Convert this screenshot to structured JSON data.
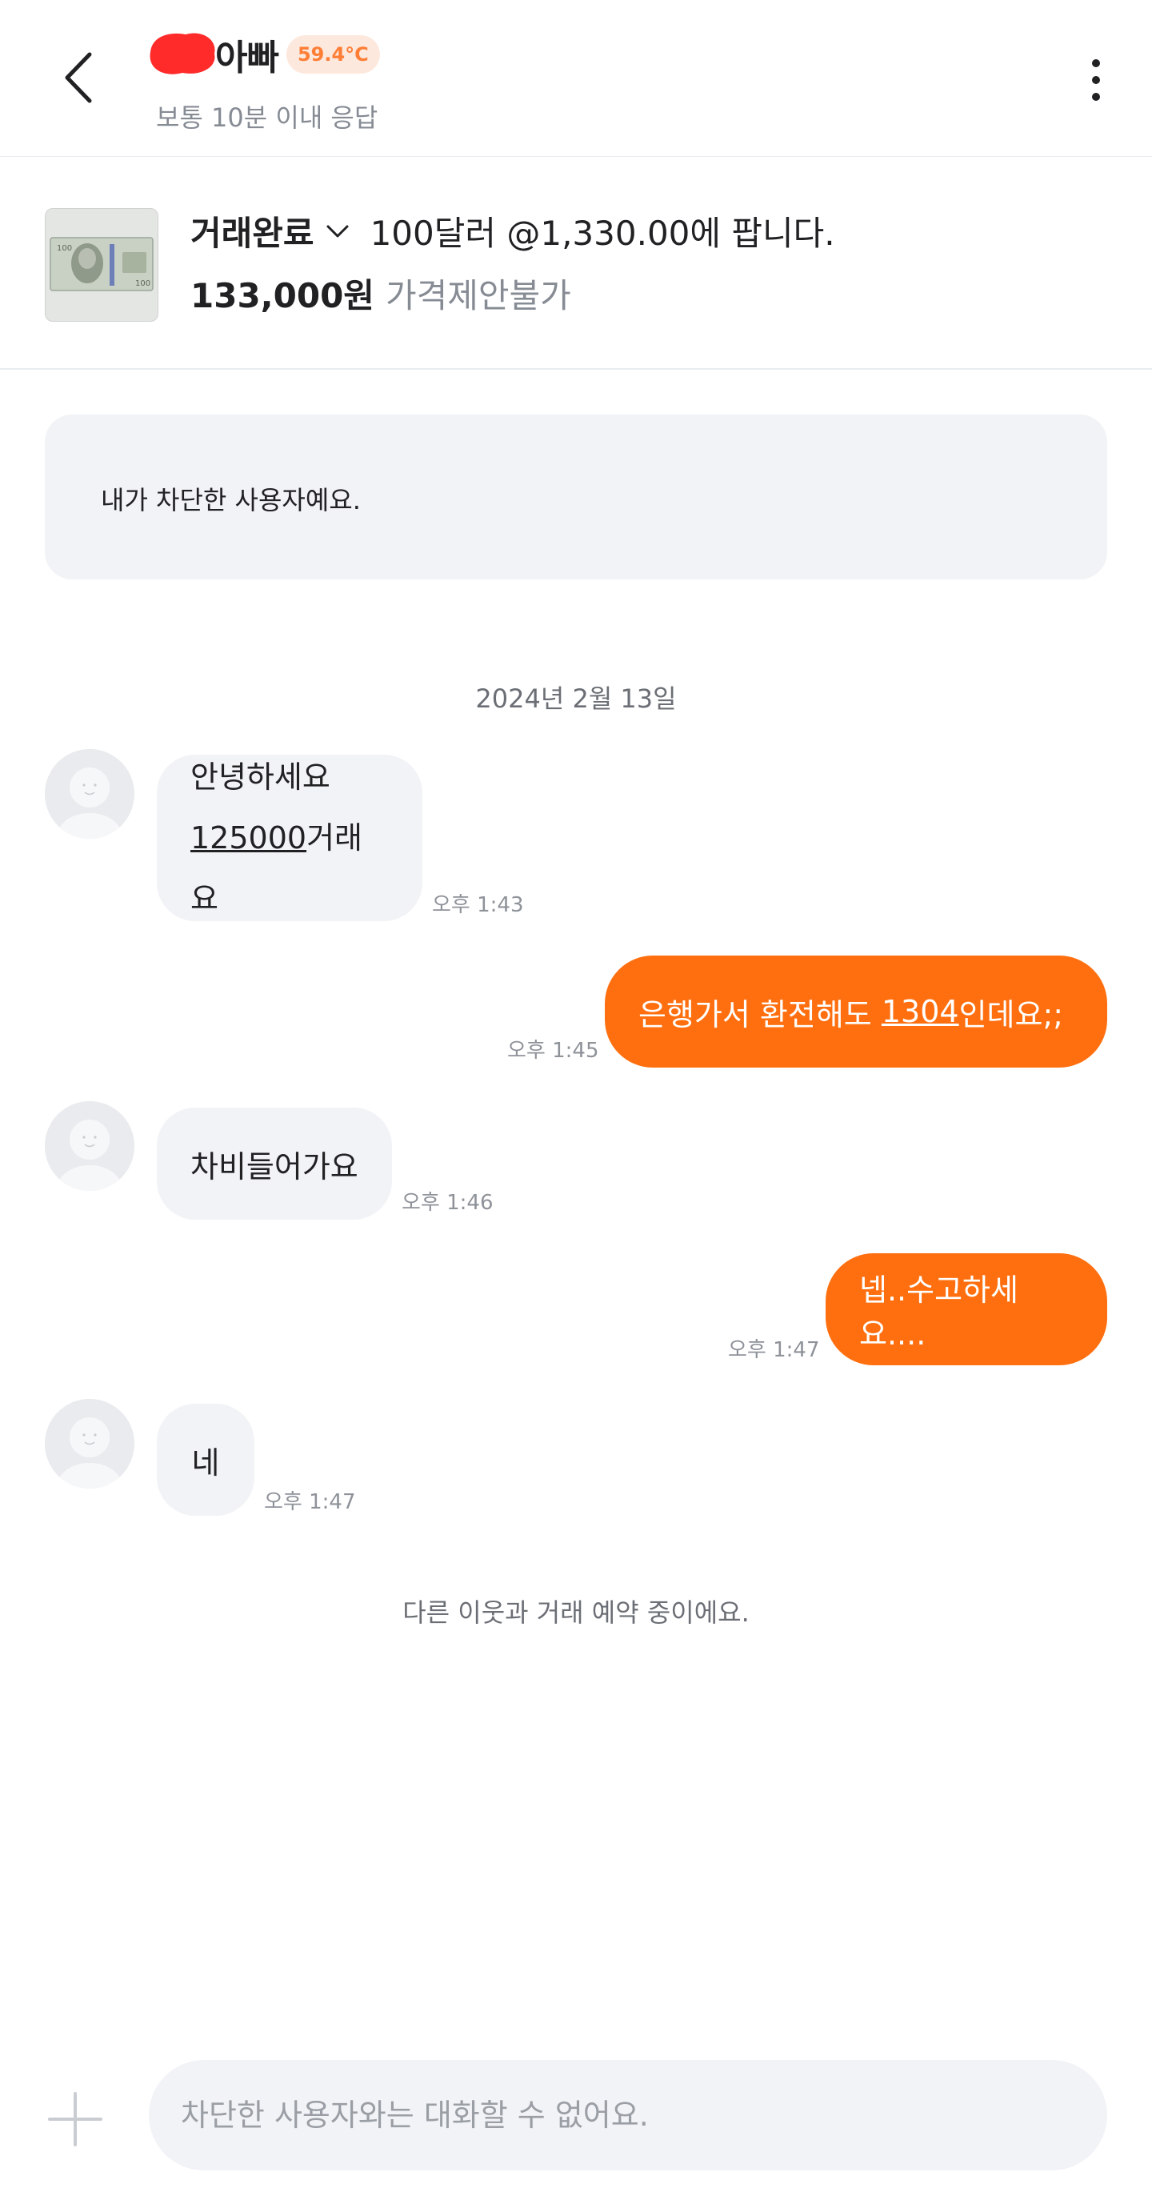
{
  "header": {
    "user_name": "아빠",
    "temperature": "59.4°C",
    "reply_time": "보통 10분 이내 응답",
    "icons": {
      "back": "back-arrow-icon",
      "more": "more-vertical-icon"
    }
  },
  "product": {
    "status": "거래완료",
    "title": "100달러 @1,330.00에 팝니다.",
    "price": "133,000원",
    "price_note": "가격제안불가"
  },
  "chat": {
    "blocked_notice": "내가 차단한 사용자예요.",
    "date": "2024년 2월 13일",
    "messages": [
      {
        "from": "them",
        "lines": [
          "안녕하세요",
          "125000거래요"
        ],
        "underline_part": "125000",
        "rest_part": "거래요",
        "time": "오후 1:43"
      },
      {
        "from": "me",
        "pre": "은행가서 환전해도 ",
        "underline_part": "1304",
        "post": "인데요;;",
        "time": "오후 1:45"
      },
      {
        "from": "them",
        "text": "차비들어가요",
        "time": "오후 1:46"
      },
      {
        "from": "me",
        "text": "넵..수고하세요....",
        "time": "오후 1:47"
      },
      {
        "from": "them",
        "text": "네",
        "time": "오후 1:47"
      }
    ],
    "system_message": "다른 이웃과 거래 예약 중이에요."
  },
  "input": {
    "placeholder": "차단한 사용자와는 대화할 수 없어요."
  },
  "colors": {
    "accent": "#ff6f0f",
    "bubble_in": "#f2f3f6",
    "muted_text": "#868b94",
    "redaction": "#ff2a2a"
  }
}
